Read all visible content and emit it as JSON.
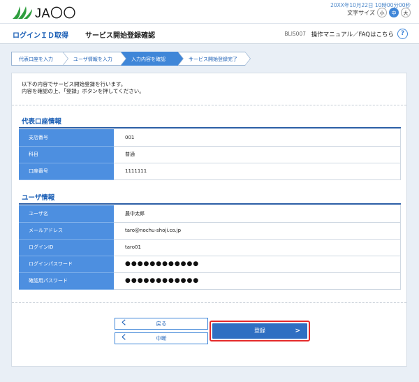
{
  "header": {
    "logo_text": "JA〇〇",
    "datetime": "20XX年10月22日 10時00分00秒",
    "fontsize_label": "文字サイズ",
    "fontsize_options": [
      "小",
      "中",
      "大"
    ],
    "fontsize_selected": "中"
  },
  "titlebar": {
    "section": "ログインＩＤ取得",
    "title": "サービス開始登録確認",
    "screen_code": "BLIS007",
    "manual_link": "操作マニュアル／FAQはこちら",
    "help_icon": "?"
  },
  "steps": [
    {
      "label": "代表口座を入力",
      "active": false
    },
    {
      "label": "ユーザ情報を入力",
      "active": false
    },
    {
      "label": "入力内容を確認",
      "active": true
    },
    {
      "label": "サービス開始登録完了",
      "active": false
    }
  ],
  "intro": {
    "line1": "以下の内容でサービス開始登録を行います。",
    "line2": "内容を確認の上、「登録」ボタンを押してください。"
  },
  "account_section": {
    "title": "代表口座情報",
    "rows": [
      {
        "label": "支店番号",
        "value": "001"
      },
      {
        "label": "科目",
        "value": "普通"
      },
      {
        "label": "口座番号",
        "value": "1111111"
      }
    ]
  },
  "user_section": {
    "title": "ユーザ情報",
    "rows": [
      {
        "label": "ユーザ名",
        "value": "農中太郎"
      },
      {
        "label": "メールアドレス",
        "value": "taro@nochu-shoji.co.jp"
      },
      {
        "label": "ログインID",
        "value": "taro01"
      },
      {
        "label": "ログインパスワード",
        "value": "●●●●●●●●●●●●"
      },
      {
        "label": "確認用パスワード",
        "value": "●●●●●●●●●●●●"
      }
    ]
  },
  "buttons": {
    "back": "戻る",
    "cancel": "中断",
    "register": "登録",
    "chevron_left": "く",
    "chevron_right": ">"
  },
  "colors": {
    "accent": "#3f86d8",
    "table_header": "#4d8fe0",
    "primary_button": "#2f6fc2",
    "highlight_border": "#e52a2a"
  }
}
